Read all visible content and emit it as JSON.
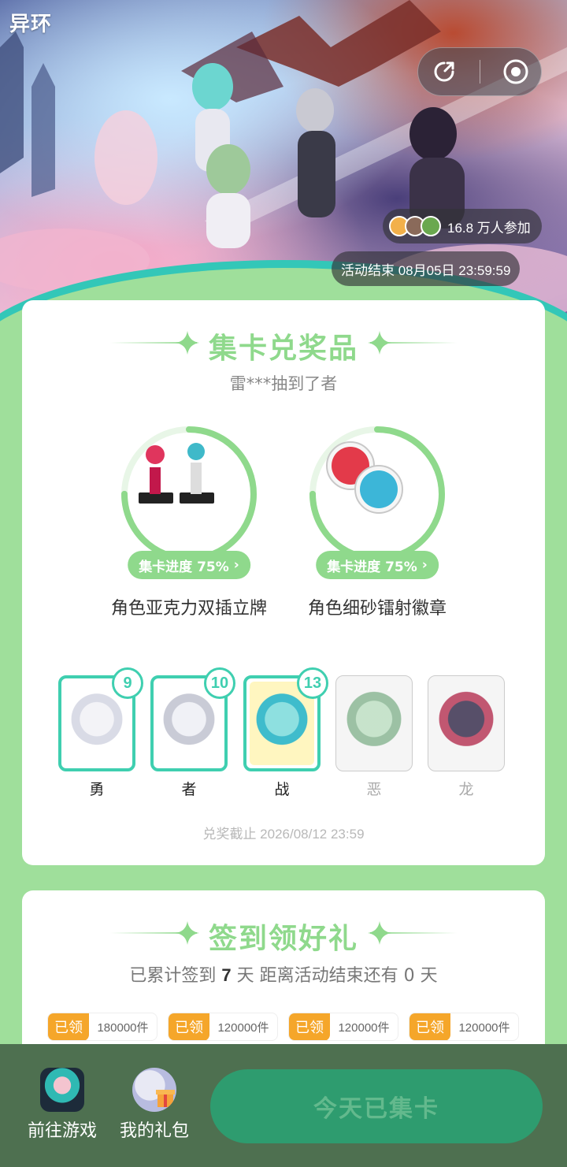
{
  "hero": {
    "logo": "异环",
    "participants": "16.8 万人参加",
    "end_time": "活动结束 08月05日 23:59:59"
  },
  "capsule": {
    "share_icon": "share-icon",
    "close_icon": "record-circle-icon"
  },
  "collect": {
    "title": "集卡兑奖品",
    "ticker": "雷***抽到了者",
    "prizes": [
      {
        "progress_label": "集卡进度 75%",
        "progress": 0.75,
        "name": "角色亚克力双插立牌"
      },
      {
        "progress_label": "集卡进度 75%",
        "progress": 0.75,
        "name": "角色细砂镭射徽章"
      }
    ],
    "cards": [
      {
        "label": "勇",
        "count": "9",
        "owned": true
      },
      {
        "label": "者",
        "count": "10",
        "owned": true
      },
      {
        "label": "战",
        "count": "13",
        "owned": true
      },
      {
        "label": "恶",
        "count": "",
        "owned": false
      },
      {
        "label": "龙",
        "count": "",
        "owned": false
      }
    ],
    "deadline": "兑奖截止 2026/08/12 23:59"
  },
  "checkin": {
    "title": "签到领好礼",
    "info_prefix": "已累计签到 ",
    "days": "7",
    "info_suffix": " 天  距离活动结束还有 0 天",
    "rewards": [
      {
        "tag": "已领",
        "qty": "180000件"
      },
      {
        "tag": "已领",
        "qty": "120000件"
      },
      {
        "tag": "已领",
        "qty": "120000件"
      },
      {
        "tag": "已领",
        "qty": "120000件"
      }
    ]
  },
  "bottom": {
    "go_game": "前往游戏",
    "my_gifts": "我的礼包",
    "main_button": "今天已集卡"
  },
  "colors": {
    "accent_green": "#8fd98c",
    "teal": "#3fcfb0",
    "orange": "#f5a62a",
    "bottom_bar": "#4e7050",
    "main_button": "#2e9c6f"
  }
}
